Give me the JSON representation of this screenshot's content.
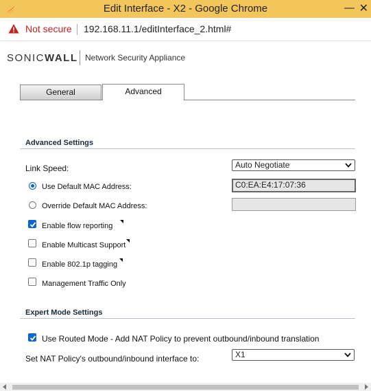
{
  "window": {
    "title": "Edit Interface - X2 - Google Chrome",
    "minimize": "—",
    "close": "✕"
  },
  "address_bar": {
    "security": "Not secure",
    "url": "192.168.11.1/editInterface_2.html#"
  },
  "header": {
    "brand_left": "SONIC",
    "brand_right": "WALL",
    "product": "Network Security Appliance"
  },
  "tabs": [
    {
      "label": "General",
      "active": false
    },
    {
      "label": "Advanced",
      "active": true
    }
  ],
  "advanced_settings": {
    "title": "Advanced Settings",
    "link_speed_label": "Link Speed:",
    "link_speed_value": "Auto Negotiate",
    "use_default_mac_label": "Use Default MAC Address:",
    "default_mac_value": "C0:EA:E4:17:07:36",
    "override_mac_label": "Override Default MAC Address:",
    "override_mac_value": "",
    "flow_reporting_label": "Enable flow reporting",
    "multicast_label": "Enable Multicast Support",
    "tagging_label": "Enable 802.1p tagging",
    "mgmt_traffic_label": "Management Traffic Only"
  },
  "expert_settings": {
    "title": "Expert Mode Settings",
    "routed_mode_label": "Use Routed Mode - Add NAT Policy to prevent outbound/inbound translation",
    "nat_interface_label": "Set NAT Policy's outbound/inbound interface to:",
    "nat_interface_value": "X1"
  },
  "state": {
    "use_default_mac": true,
    "flow_reporting": true,
    "multicast": false,
    "tagging": false,
    "mgmt_traffic": false,
    "routed_mode": true
  },
  "colors": {
    "titlebar": "#f2c65a",
    "accent": "#0a66d0",
    "warning": "#c5221f"
  }
}
